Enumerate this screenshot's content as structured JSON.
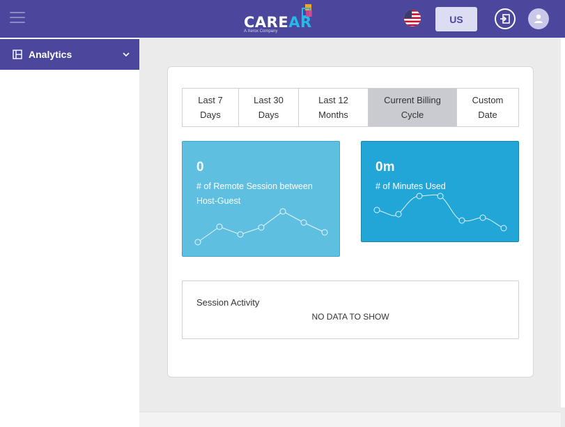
{
  "header": {
    "brand_prefix": "CARE",
    "brand_suffix": "AR",
    "brand_tm": "™",
    "brand_tagline": "A Xerox Company",
    "language_button": "US"
  },
  "sidebar": {
    "items": [
      {
        "label": "Analytics",
        "icon": "dashboard-icon"
      }
    ]
  },
  "filters": {
    "tabs": [
      {
        "line1": "Last 7",
        "line2": "Days"
      },
      {
        "line1": "Last 30",
        "line2": "Days"
      },
      {
        "line1": "Last 12",
        "line2": "Months"
      },
      {
        "line1": "Current Billing",
        "line2": "Cycle"
      },
      {
        "line1": "Custom",
        "line2": "Date"
      }
    ],
    "active_index": 3
  },
  "stats": [
    {
      "value": "0",
      "label": "# of Remote Session between Host-Guest",
      "color": "#5ebfe0"
    },
    {
      "value": "0m",
      "label": "# of Minutes Used",
      "color": "#22a6d8"
    }
  ],
  "activity": {
    "title": "Session Activity",
    "empty_message": "NO DATA TO SHOW"
  },
  "colors": {
    "header_bg": "#4b479d",
    "accent": "#27b8e6",
    "content_bg": "#ebebeb"
  }
}
